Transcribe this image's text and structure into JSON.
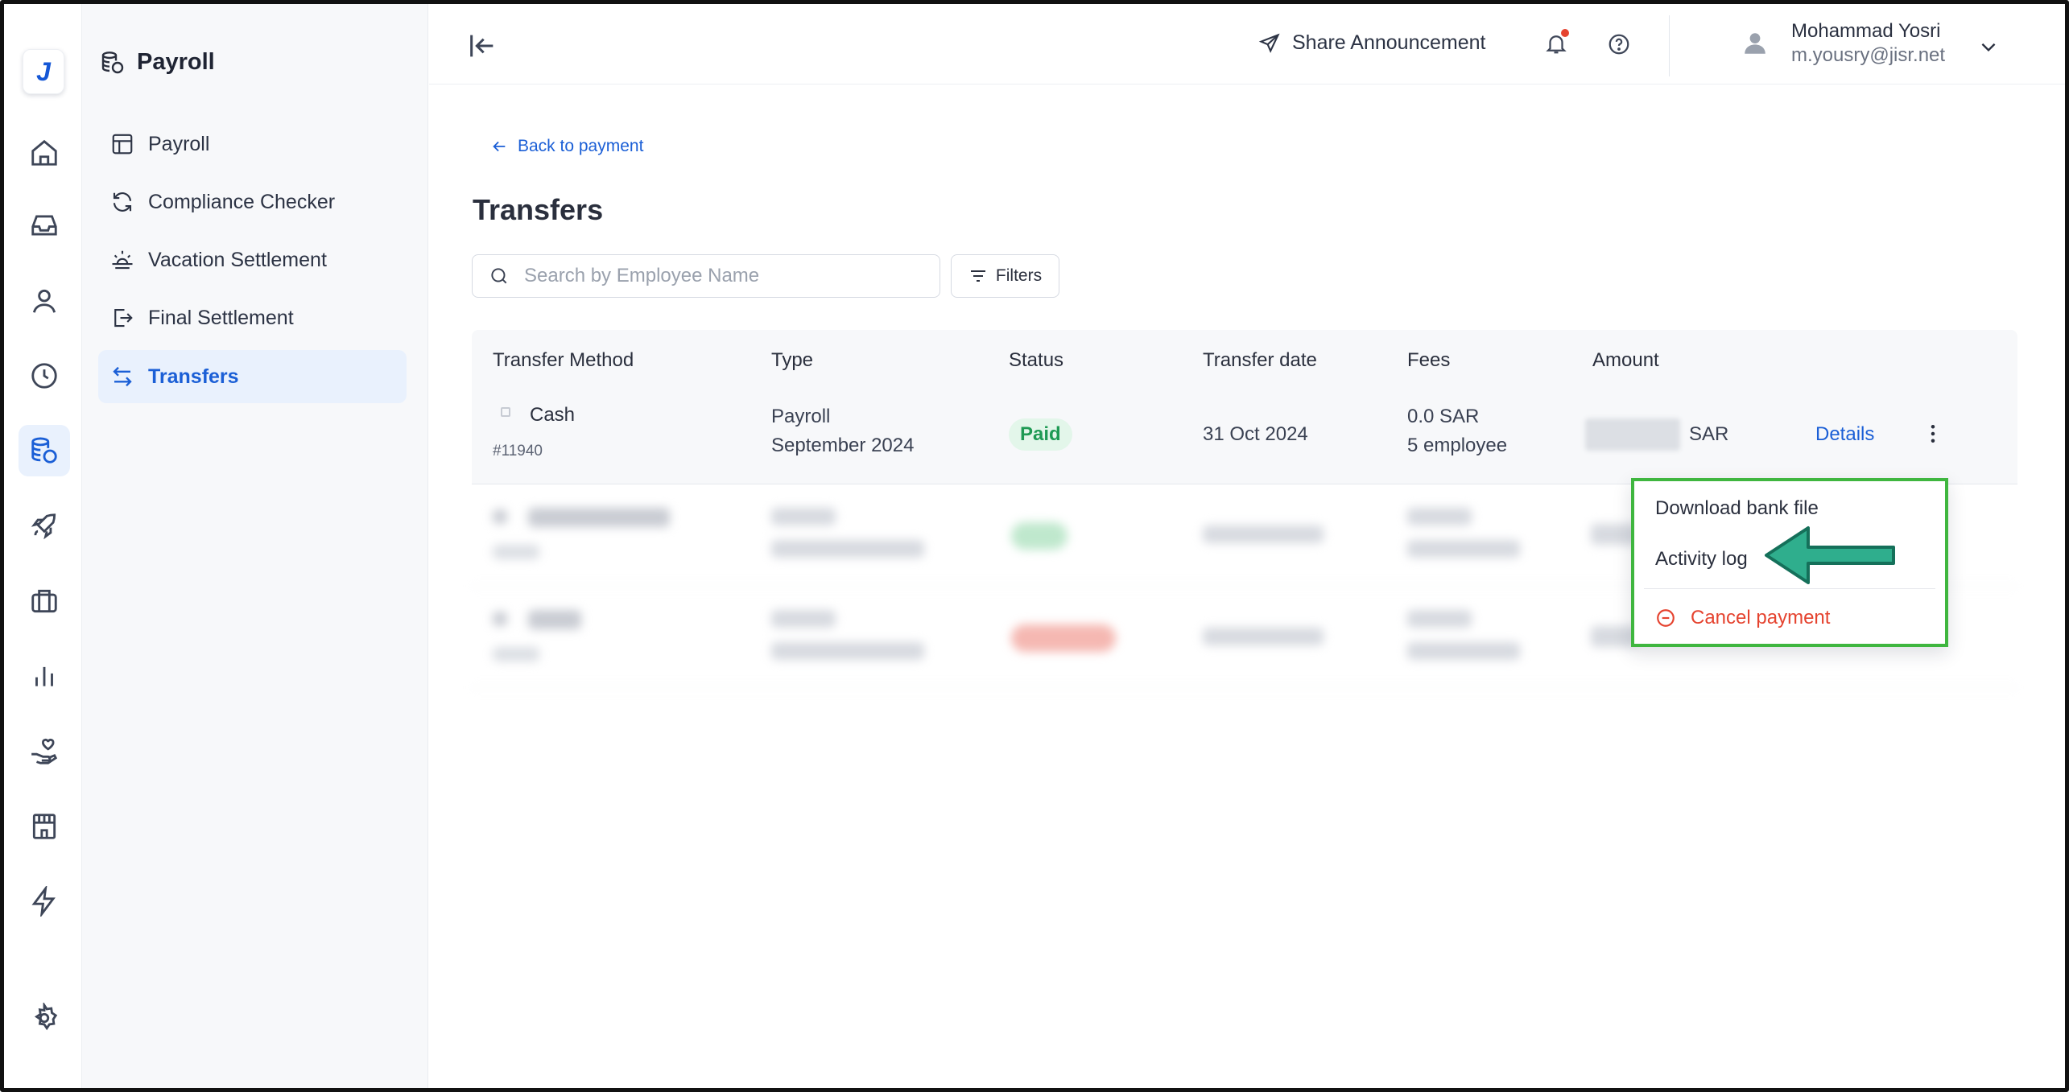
{
  "app": {
    "logo_letter": "J",
    "brand_color": "#1b5fd6"
  },
  "rail": {
    "items": [
      {
        "name": "home-icon",
        "active": false
      },
      {
        "name": "inbox-icon",
        "active": false
      },
      {
        "name": "user-icon",
        "active": false
      },
      {
        "name": "clock-icon",
        "active": false
      },
      {
        "name": "payroll-coins-icon",
        "active": true
      },
      {
        "name": "rocket-icon",
        "active": false
      },
      {
        "name": "briefcase-icon",
        "active": false
      },
      {
        "name": "bar-chart-icon",
        "active": false
      },
      {
        "name": "hand-heart-icon",
        "active": false
      },
      {
        "name": "store-icon",
        "active": false
      },
      {
        "name": "lightning-icon",
        "active": false
      },
      {
        "name": "gear-icon",
        "active": false
      }
    ]
  },
  "subnav": {
    "title": "Payroll",
    "items": [
      {
        "label": "Payroll",
        "icon": "table-icon",
        "active": false
      },
      {
        "label": "Compliance Checker",
        "icon": "refresh-icon",
        "active": false
      },
      {
        "label": "Vacation Settlement",
        "icon": "sunset-icon",
        "active": false
      },
      {
        "label": "Final Settlement",
        "icon": "exit-icon",
        "active": false
      },
      {
        "label": "Transfers",
        "icon": "transfer-arrows-icon",
        "active": true
      }
    ]
  },
  "topbar": {
    "share_label": "Share Announcement",
    "user_name": "Mohammad Yosri",
    "user_email": "m.yousry@jisr.net",
    "notification_color": "#e5432f"
  },
  "main": {
    "back_label": "Back to payment",
    "title": "Transfers",
    "search_placeholder": "Search by Employee Name",
    "filters_label": "Filters"
  },
  "table": {
    "columns": [
      "Transfer Method",
      "Type",
      "Status",
      "Transfer date",
      "Fees",
      "Amount"
    ],
    "row": {
      "method": "Cash",
      "id": "#11940",
      "type_line1": "Payroll",
      "type_line2": "September 2024",
      "status": "Paid",
      "date": "31 Oct 2024",
      "fees_line1": "0.0 SAR",
      "fees_line2": "5 employee",
      "currency": "SAR",
      "details_label": "Details"
    }
  },
  "menu": {
    "download_label": "Download bank file",
    "activity_label": "Activity log",
    "cancel_label": "Cancel payment",
    "highlight_color": "#3fb63f",
    "arrow_color": "#2fae8d"
  }
}
